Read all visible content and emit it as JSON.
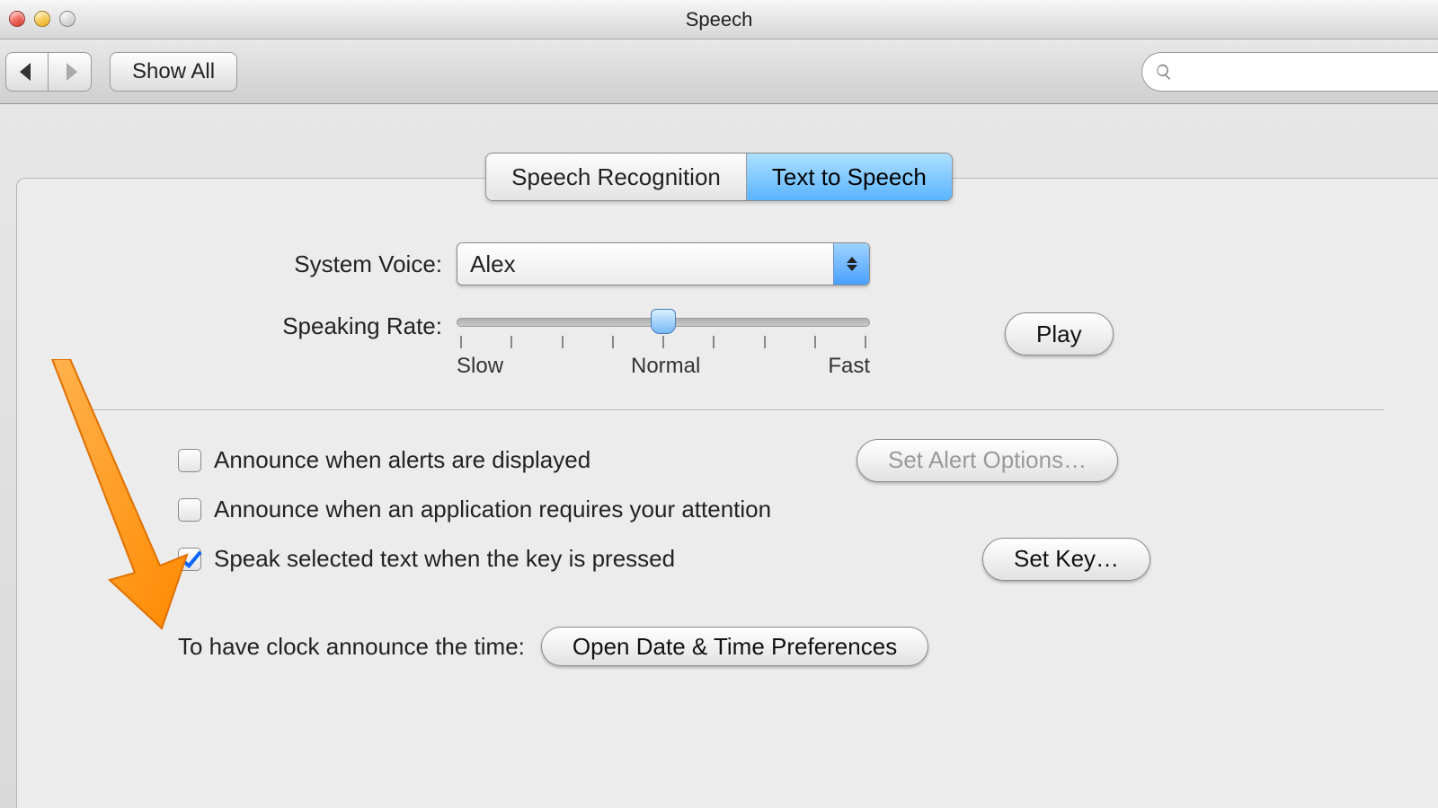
{
  "window": {
    "title": "Speech"
  },
  "toolbar": {
    "show_all": "Show All",
    "search_placeholder": ""
  },
  "tabs": {
    "speech_recognition": "Speech Recognition",
    "text_to_speech": "Text to Speech"
  },
  "voice": {
    "label": "System Voice:",
    "value": "Alex"
  },
  "rate": {
    "label": "Speaking Rate:",
    "tick_slow": "Slow",
    "tick_normal": "Normal",
    "tick_fast": "Fast",
    "play": "Play"
  },
  "announce": {
    "alerts": "Announce when alerts are displayed",
    "attention": "Announce when an application requires your attention",
    "speak_selected": "Speak selected text when the key is pressed",
    "set_alert_options": "Set Alert Options…",
    "set_key": "Set Key…"
  },
  "clock": {
    "label": "To have clock announce the time:",
    "button": "Open Date & Time Preferences"
  }
}
